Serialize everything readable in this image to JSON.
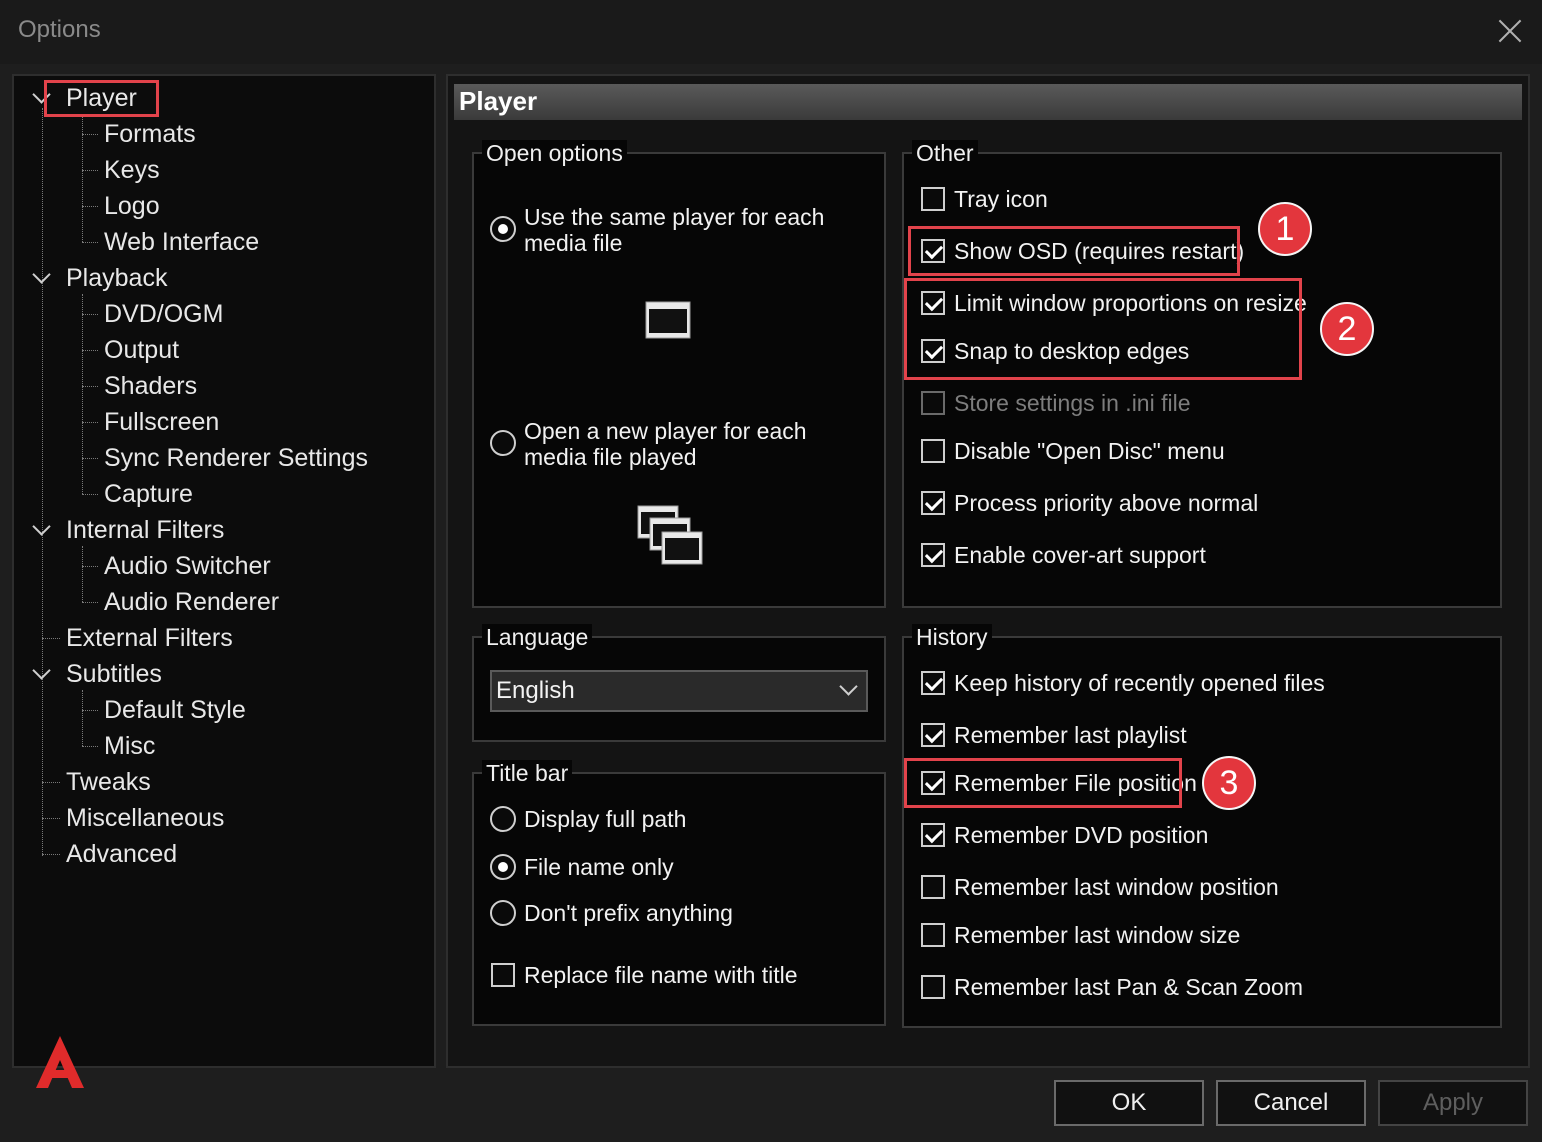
{
  "window": {
    "title": "Options"
  },
  "tree": {
    "items": [
      {
        "label": "Player",
        "expanded": true,
        "selected": true
      },
      {
        "label": "Formats"
      },
      {
        "label": "Keys"
      },
      {
        "label": "Logo"
      },
      {
        "label": "Web Interface"
      },
      {
        "label": "Playback",
        "expanded": true
      },
      {
        "label": "DVD/OGM"
      },
      {
        "label": "Output"
      },
      {
        "label": "Shaders"
      },
      {
        "label": "Fullscreen"
      },
      {
        "label": "Sync Renderer Settings"
      },
      {
        "label": "Capture"
      },
      {
        "label": "Internal Filters",
        "expanded": true
      },
      {
        "label": "Audio Switcher"
      },
      {
        "label": "Audio Renderer"
      },
      {
        "label": "External Filters"
      },
      {
        "label": "Subtitles",
        "expanded": true
      },
      {
        "label": "Default Style"
      },
      {
        "label": "Misc"
      },
      {
        "label": "Tweaks"
      },
      {
        "label": "Miscellaneous"
      },
      {
        "label": "Advanced"
      }
    ]
  },
  "page": {
    "title": "Player"
  },
  "open_options": {
    "title": "Open options",
    "same_player_label": "Use the same player for each media file",
    "same_player_selected": true,
    "new_player_label": "Open a new player for each media file played",
    "new_player_selected": false
  },
  "language": {
    "title": "Language",
    "value": "English"
  },
  "title_bar": {
    "title": "Title bar",
    "display_full_path": "Display full path",
    "file_name_only": "File name only",
    "dont_prefix": "Don't prefix anything",
    "selected": "File name only",
    "replace_file_name": "Replace file name with title",
    "replace_file_name_checked": false
  },
  "other": {
    "title": "Other",
    "items": [
      {
        "label": "Tray icon",
        "checked": false,
        "enabled": true
      },
      {
        "label": "Show OSD (requires restart)",
        "checked": true,
        "enabled": true
      },
      {
        "label": "Limit window proportions on resize",
        "checked": true,
        "enabled": true
      },
      {
        "label": "Snap to desktop edges",
        "checked": true,
        "enabled": true
      },
      {
        "label": "Store settings in .ini file",
        "checked": false,
        "enabled": false
      },
      {
        "label": "Disable \"Open Disc\" menu",
        "checked": false,
        "enabled": true
      },
      {
        "label": "Process priority above normal",
        "checked": true,
        "enabled": true
      },
      {
        "label": "Enable cover-art support",
        "checked": true,
        "enabled": true
      }
    ]
  },
  "history": {
    "title": "History",
    "items": [
      {
        "label": "Keep history of recently opened files",
        "checked": true
      },
      {
        "label": "Remember last playlist",
        "checked": true
      },
      {
        "label": "Remember File position",
        "checked": true
      },
      {
        "label": "Remember DVD position",
        "checked": true
      },
      {
        "label": "Remember last window position",
        "checked": false
      },
      {
        "label": "Remember last window size",
        "checked": false
      },
      {
        "label": "Remember last Pan & Scan Zoom",
        "checked": false
      }
    ]
  },
  "annotations": [
    "1",
    "2",
    "3"
  ],
  "buttons": {
    "ok": "OK",
    "cancel": "Cancel",
    "apply": "Apply"
  },
  "colors": {
    "highlight": "#e2434b",
    "badge": "#e3363d",
    "logo": "#e02b2b"
  },
  "logo": {
    "icon": "app-logo-icon"
  }
}
